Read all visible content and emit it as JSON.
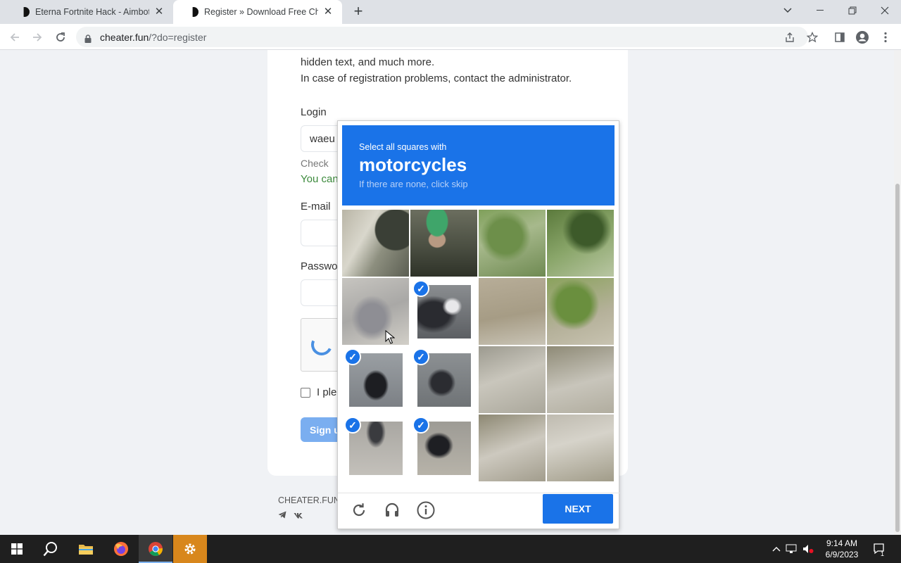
{
  "browser": {
    "tabs": [
      {
        "title": "Eterna Fortnite Hack - Aimbot, ESP",
        "active": false
      },
      {
        "title": "Register » Download Free Cheats",
        "active": true
      }
    ],
    "url_host": "cheater.fun",
    "url_rest": "/?do=register"
  },
  "page": {
    "intro_line1": "hidden text, and much more.",
    "intro_line2": "In case of registration problems, contact the administrator.",
    "login_label": "Login",
    "login_value": "waeu",
    "check_label": "Check",
    "check_result": "You can",
    "email_label": "E-mail",
    "password_label": "Passwo",
    "agree_text": "I ple",
    "signup_label": "Sign u",
    "footer_brand": "CHEATER.FUN"
  },
  "captcha": {
    "instruction": "Select all squares with",
    "target": "motorcycles",
    "hint": "If there are none, click skip",
    "selected_tiles": [
      5,
      8,
      9,
      12,
      13
    ],
    "next_label": "NEXT",
    "accent": "#1a73e8"
  },
  "taskbar": {
    "time": "9:14 AM",
    "date": "6/9/2023",
    "notification_count": "1"
  }
}
